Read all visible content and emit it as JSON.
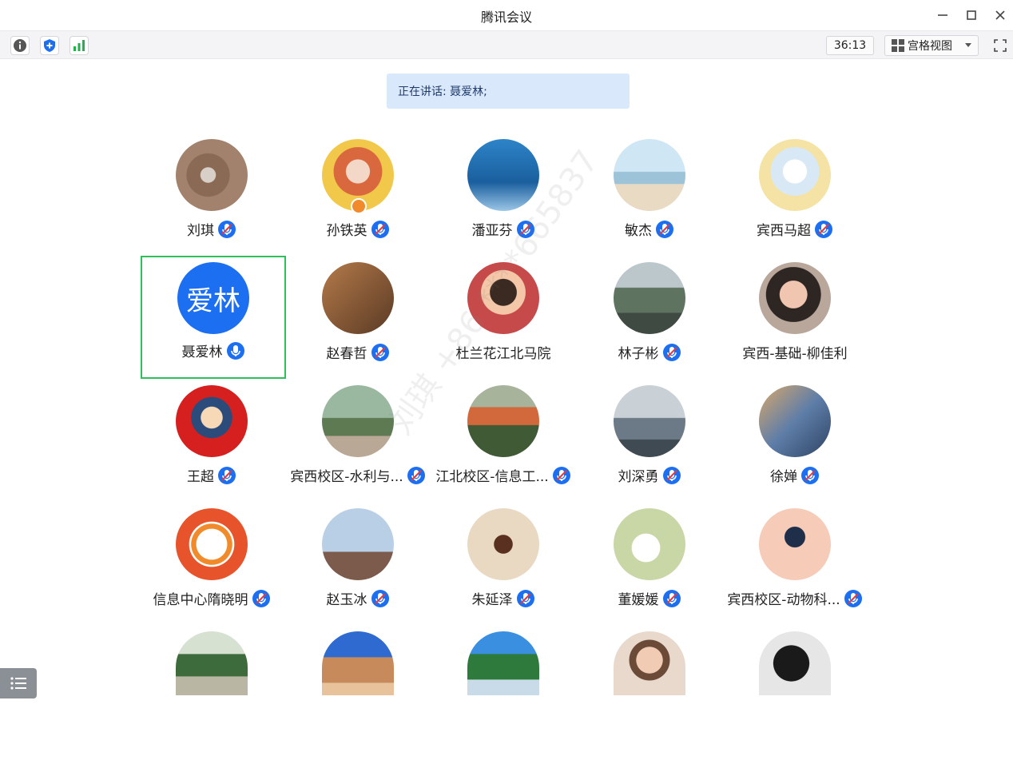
{
  "window": {
    "title": "腾讯会议"
  },
  "toolbar": {
    "timer": "36:13",
    "view_label": "宫格视图"
  },
  "speaking": {
    "text": "正在讲话: 聂爱林;"
  },
  "watermark": {
    "text": "刘琪 +86 ****665837"
  },
  "participants": [
    {
      "name": "刘琪",
      "mic": "on"
    },
    {
      "name": "孙铁英",
      "mic": "on"
    },
    {
      "name": "潘亚芬",
      "mic": "on"
    },
    {
      "name": "敏杰",
      "mic": "on"
    },
    {
      "name": "宾西马超",
      "mic": "on"
    },
    {
      "name": "聂爱林",
      "mic": "speaking",
      "initials": "爱林"
    },
    {
      "name": "赵春哲",
      "mic": "on"
    },
    {
      "name": "杜兰花江北马院",
      "mic": "none"
    },
    {
      "name": "林子彬",
      "mic": "on"
    },
    {
      "name": "宾西-基础-柳佳利",
      "mic": "none"
    },
    {
      "name": "王超",
      "mic": "on"
    },
    {
      "name": "宾西校区-水利与...",
      "mic": "on"
    },
    {
      "name": "江北校区-信息工...",
      "mic": "on"
    },
    {
      "name": "刘深勇",
      "mic": "on"
    },
    {
      "name": "徐婵",
      "mic": "on"
    },
    {
      "name": "信息中心隋晓明",
      "mic": "on"
    },
    {
      "name": "赵玉冰",
      "mic": "on"
    },
    {
      "name": "朱延泽",
      "mic": "on"
    },
    {
      "name": "董媛媛",
      "mic": "on"
    },
    {
      "name": "宾西校区-动物科...",
      "mic": "on"
    },
    {
      "name": "",
      "mic": "none"
    },
    {
      "name": "",
      "mic": "none"
    },
    {
      "name": "",
      "mic": "none"
    },
    {
      "name": "",
      "mic": "none"
    },
    {
      "name": "",
      "mic": "none"
    }
  ],
  "colors": {
    "accent": "#1d6ff2",
    "speaking_bg": "#d9e8fb",
    "active_border": "#2fbf5a",
    "mic_muted": "#1d6ff2"
  }
}
